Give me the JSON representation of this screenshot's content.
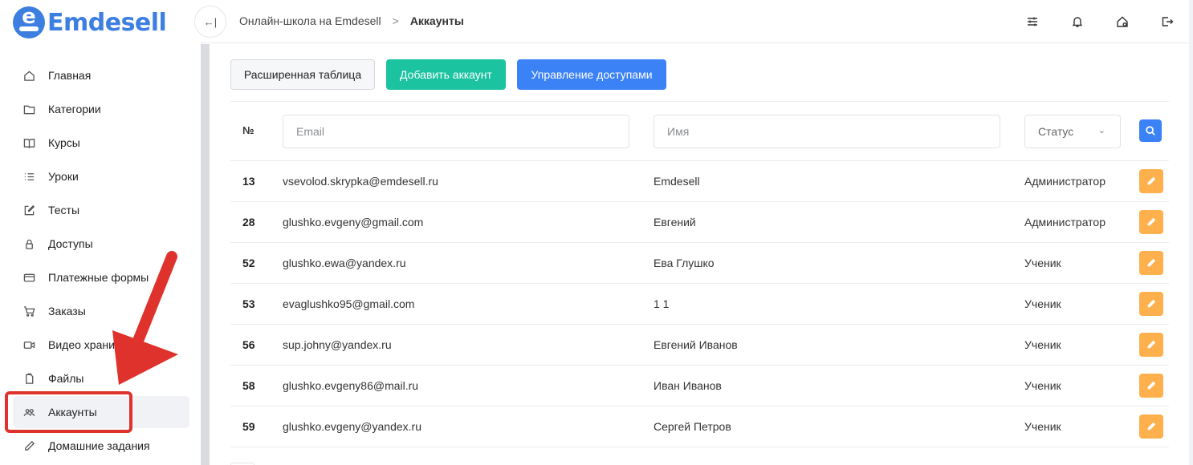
{
  "logo": {
    "brand": "Emdesell",
    "letter": "e"
  },
  "sidebar": {
    "items": [
      {
        "label": "Главная",
        "icon": "home-icon"
      },
      {
        "label": "Категории",
        "icon": "folder-icon"
      },
      {
        "label": "Курсы",
        "icon": "book-icon"
      },
      {
        "label": "Уроки",
        "icon": "list-icon"
      },
      {
        "label": "Тесты",
        "icon": "edit-square-icon"
      },
      {
        "label": "Доступы",
        "icon": "lock-icon"
      },
      {
        "label": "Платежные формы",
        "icon": "credit-card-icon"
      },
      {
        "label": "Заказы",
        "icon": "cart-icon"
      },
      {
        "label": "Видео хранилище",
        "icon": "video-icon"
      },
      {
        "label": "Файлы",
        "icon": "file-icon"
      },
      {
        "label": "Аккаунты",
        "icon": "users-icon",
        "active": true
      },
      {
        "label": "Домашние задания",
        "icon": "pencil-icon"
      }
    ]
  },
  "header": {
    "breadcrumb_root": "Онлайн-школа на Emdesell",
    "breadcrumb_sep": ">",
    "breadcrumb_current": "Аккаунты",
    "collapse_glyph": "←|"
  },
  "toolbar": {
    "extended_table": "Расширенная таблица",
    "add_account": "Добавить аккаунт",
    "manage_access": "Управление доступами"
  },
  "filters": {
    "number_header": "№",
    "email_placeholder": "Email",
    "name_placeholder": "Имя",
    "status_label": "Статус"
  },
  "accounts": [
    {
      "id": "13",
      "email": "vsevolod.skrypka@emdesell.ru",
      "name": "Emdesell",
      "role": "Администратор"
    },
    {
      "id": "28",
      "email": "glushko.evgeny@gmail.com",
      "name": "Евгений",
      "role": "Администратор"
    },
    {
      "id": "52",
      "email": "glushko.ewa@yandex.ru",
      "name": "Ева Глушко",
      "role": "Ученик"
    },
    {
      "id": "53",
      "email": "evaglushko95@gmail.com",
      "name": "1 1",
      "role": "Ученик"
    },
    {
      "id": "56",
      "email": "sup.johny@yandex.ru",
      "name": "Евгений Иванов",
      "role": "Ученик"
    },
    {
      "id": "58",
      "email": "glushko.evgeny86@mail.ru",
      "name": "Иван Иванов",
      "role": "Ученик"
    },
    {
      "id": "59",
      "email": "glushko.evgeny@yandex.ru",
      "name": "Сергей Петров",
      "role": "Ученик"
    }
  ],
  "colors": {
    "brand": "#3d7fe0",
    "green": "#1bc3a1",
    "blue": "#3b82f6",
    "edit": "#fdb04b",
    "annotation": "#e0322c"
  }
}
